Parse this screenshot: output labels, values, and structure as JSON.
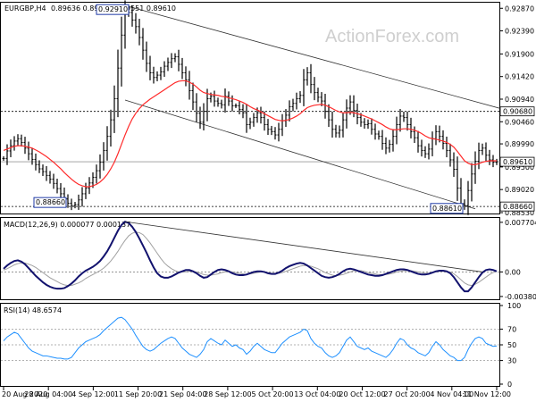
{
  "header": {
    "symbol": "EURGBP,H4",
    "ohlc": "0.89636 0.89731 0.89551 0.89610"
  },
  "watermark": "ActionForex.com",
  "chart_data": {
    "type": "candlestick",
    "price_axis": {
      "ticks": [
        "0.92870",
        "0.92390",
        "0.91900",
        "0.91420",
        "0.90940",
        "0.90460",
        "0.89990",
        "0.89500",
        "0.89020",
        "0.88530"
      ],
      "ylim": [
        0.8853,
        0.9297
      ]
    },
    "price_labels": [
      {
        "text": "0.90680",
        "value": 0.9068,
        "kind": "level"
      },
      {
        "text": "0.89610",
        "value": 0.8961,
        "kind": "current"
      },
      {
        "text": "0.88660",
        "value": 0.8866,
        "kind": "level"
      }
    ],
    "annotations": [
      {
        "text": "0.92910",
        "value": 0.9291,
        "x_index": 34
      },
      {
        "text": "0.88660",
        "value": 0.8866,
        "x_index": 20
      },
      {
        "text": "0.88610",
        "value": 0.8861,
        "x_index": 129
      }
    ],
    "horizontal_levels": [
      0.9068,
      0.8866
    ],
    "current_price": 0.8961,
    "time_axis": [
      "20 Aug 2020",
      "28 Aug 04:00",
      "4 Sep 12:00",
      "11 Sep 20:00",
      "21 Sep 04:00",
      "28 Sep 12:00",
      "5 Oct 20:00",
      "13 Oct 04:00",
      "20 Oct 12:00",
      "27 Oct 20:00",
      "4 Nov 04:00",
      "11 Nov 12:00"
    ],
    "close": [
      0.8968,
      0.8984,
      0.8995,
      0.9005,
      0.901,
      0.9002,
      0.899,
      0.8978,
      0.8966,
      0.8955,
      0.8946,
      0.894,
      0.8932,
      0.8924,
      0.8915,
      0.8904,
      0.8893,
      0.8882,
      0.8873,
      0.8868,
      0.887,
      0.888,
      0.8893,
      0.8905,
      0.8916,
      0.8928,
      0.8942,
      0.896,
      0.8985,
      0.9015,
      0.905,
      0.9095,
      0.916,
      0.923,
      0.9275,
      0.9278,
      0.9262,
      0.9248,
      0.9225,
      0.9198,
      0.917,
      0.915,
      0.914,
      0.9145,
      0.9152,
      0.9164,
      0.9172,
      0.918,
      0.9184,
      0.9168,
      0.915,
      0.9135,
      0.9112,
      0.9088,
      0.9064,
      0.9045,
      0.9068,
      0.9095,
      0.91,
      0.909,
      0.9085,
      0.9082,
      0.91,
      0.909,
      0.908,
      0.908,
      0.9072,
      0.9065,
      0.904,
      0.9045,
      0.9055,
      0.9065,
      0.9055,
      0.904,
      0.903,
      0.9025,
      0.9018,
      0.903,
      0.9048,
      0.906,
      0.9078,
      0.9085,
      0.9095,
      0.9102,
      0.9135,
      0.915,
      0.9125,
      0.9108,
      0.9098,
      0.909,
      0.9068,
      0.905,
      0.903,
      0.9022,
      0.9028,
      0.905,
      0.9075,
      0.9088,
      0.907,
      0.9055,
      0.9045,
      0.904,
      0.9042,
      0.903,
      0.902,
      0.9015,
      0.9,
      0.899,
      0.8998,
      0.9015,
      0.904,
      0.9058,
      0.9055,
      0.904,
      0.9025,
      0.9012,
      0.8995,
      0.8985,
      0.8978,
      0.8988,
      0.901,
      0.9025,
      0.9015,
      0.9,
      0.8985,
      0.8965,
      0.8945,
      0.8905,
      0.8872,
      0.8868,
      0.89,
      0.8935,
      0.8962,
      0.8985,
      0.899,
      0.8975,
      0.8965,
      0.896,
      0.8961
    ],
    "ma": [
      0.8985,
      0.8988,
      0.8991,
      0.8994,
      0.8995,
      0.8995,
      0.8994,
      0.8992,
      0.899,
      0.8986,
      0.8982,
      0.8977,
      0.8972,
      0.8966,
      0.896,
      0.8953,
      0.8946,
      0.8938,
      0.8931,
      0.8924,
      0.8918,
      0.8913,
      0.891,
      0.8908,
      0.8908,
      0.891,
      0.8913,
      0.8918,
      0.8925,
      0.8934,
      0.8946,
      0.896,
      0.8978,
      0.8998,
      0.9018,
      0.9036,
      0.9052,
      0.9064,
      0.9074,
      0.9082,
      0.9088,
      0.9094,
      0.9099,
      0.9104,
      0.9109,
      0.9114,
      0.9119,
      0.9124,
      0.9129,
      0.9132,
      0.9133,
      0.9133,
      0.913,
      0.9126,
      0.912,
      0.9113,
      0.9108,
      0.9106,
      0.9104,
      0.9103,
      0.9102,
      0.91,
      0.9099,
      0.9097,
      0.9095,
      0.9093,
      0.909,
      0.9087,
      0.9083,
      0.9078,
      0.9074,
      0.9071,
      0.9067,
      0.9063,
      0.9059,
      0.9055,
      0.9051,
      0.9049,
      0.9048,
      0.9049,
      0.9051,
      0.9054,
      0.9058,
      0.9063,
      0.907,
      0.9076,
      0.9079,
      0.9081,
      0.9082,
      0.9083,
      0.9081,
      0.9078,
      0.9074,
      0.907,
      0.9067,
      0.9065,
      0.9065,
      0.9066,
      0.9065,
      0.9063,
      0.9061,
      0.9058,
      0.9055,
      0.9052,
      0.9048,
      0.9044,
      0.904,
      0.9035,
      0.9031,
      0.9029,
      0.9029,
      0.903,
      0.9031,
      0.9031,
      0.903,
      0.9028,
      0.9025,
      0.9021,
      0.9016,
      0.9012,
      0.901,
      0.9009,
      0.9007,
      0.9005,
      0.9002,
      0.8998,
      0.8992,
      0.8983,
      0.8973,
      0.8963,
      0.8958,
      0.8955,
      0.8955,
      0.8957,
      0.896,
      0.8962,
      0.8963,
      0.8963,
      0.8963
    ],
    "channel": {
      "upper": [
        [
          34,
          0.9293
        ],
        [
          142,
          0.9068
        ]
      ],
      "lower": [
        [
          34,
          0.9092
        ],
        [
          132,
          0.8861
        ]
      ]
    },
    "macd": {
      "label": "MACD(12,26,9) 0.000077 0.000137",
      "ticks": [
        "0.007704",
        "0.00",
        "-0.003804"
      ],
      "ylim": [
        -0.0041,
        0.0081
      ],
      "main": [
        0.0005,
        0.001,
        0.0014,
        0.0017,
        0.0018,
        0.0016,
        0.0012,
        0.0006,
        0.0,
        -0.0006,
        -0.0011,
        -0.0016,
        -0.002,
        -0.0023,
        -0.0025,
        -0.0026,
        -0.0026,
        -0.0025,
        -0.0022,
        -0.0018,
        -0.0013,
        -0.0007,
        -0.0002,
        0.0002,
        0.0005,
        0.0008,
        0.0012,
        0.0017,
        0.0024,
        0.0032,
        0.0042,
        0.0053,
        0.0064,
        0.0073,
        0.0078,
        0.0076,
        0.007,
        0.0062,
        0.0052,
        0.0041,
        0.003,
        0.0018,
        0.0007,
        -0.0002,
        -0.0007,
        -0.0009,
        -0.0009,
        -0.0007,
        -0.0004,
        -0.0001,
        0.0001,
        0.0003,
        0.0003,
        0.0001,
        -0.0002,
        -0.0006,
        -0.0009,
        -0.0008,
        -0.0004,
        0.0,
        0.0003,
        0.0004,
        0.0003,
        0.0001,
        -0.0002,
        -0.0004,
        -0.0005,
        -0.0005,
        -0.0004,
        -0.0002,
        0.0,
        0.0001,
        0.0001,
        0.0,
        -0.0002,
        -0.0003,
        -0.0003,
        -0.0001,
        0.0002,
        0.0006,
        0.0009,
        0.0011,
        0.0013,
        0.0014,
        0.0013,
        0.001,
        0.0006,
        0.0002,
        -0.0002,
        -0.0006,
        -0.0008,
        -0.0009,
        -0.0008,
        -0.0006,
        -0.0003,
        0.0001,
        0.0004,
        0.0005,
        0.0004,
        0.0002,
        0.0,
        -0.0002,
        -0.0004,
        -0.0005,
        -0.0006,
        -0.0006,
        -0.0005,
        -0.0003,
        -0.0001,
        0.0001,
        0.0003,
        0.0004,
        0.0004,
        0.0003,
        0.0001,
        -0.0001,
        -0.0003,
        -0.0004,
        -0.0004,
        -0.0003,
        -0.0001,
        0.0001,
        0.0002,
        0.0002,
        0.0001,
        -0.0002,
        -0.0008,
        -0.0016,
        -0.0024,
        -0.003,
        -0.003,
        -0.0024,
        -0.0016,
        -0.0008,
        -0.0001,
        0.0003,
        0.0004,
        0.0003,
        0.0001
      ],
      "signal": [
        0.0003,
        0.0005,
        0.0008,
        0.0011,
        0.0013,
        0.0014,
        0.0014,
        0.0012,
        0.001,
        0.0007,
        0.0003,
        -0.0001,
        -0.0005,
        -0.0009,
        -0.0012,
        -0.0015,
        -0.0018,
        -0.002,
        -0.0021,
        -0.0021,
        -0.0019,
        -0.0017,
        -0.0014,
        -0.001,
        -0.0007,
        -0.0004,
        -0.0001,
        0.0002,
        0.0006,
        0.0011,
        0.0017,
        0.0024,
        0.0032,
        0.0041,
        0.0049,
        0.0056,
        0.006,
        0.0062,
        0.0061,
        0.0058,
        0.0052,
        0.0045,
        0.0037,
        0.0029,
        0.0021,
        0.0014,
        0.0009,
        0.0005,
        0.0002,
        0.0,
        0.0,
        0.0,
        0.0001,
        0.0001,
        0.0,
        -0.0002,
        -0.0004,
        -0.0005,
        -0.0005,
        -0.0004,
        -0.0003,
        -0.0001,
        0.0,
        0.0001,
        0.0,
        -0.0001,
        -0.0002,
        -0.0003,
        -0.0004,
        -0.0003,
        -0.0002,
        -0.0001,
        0.0,
        0.0,
        -0.0001,
        -0.0002,
        -0.0002,
        -0.0002,
        -0.0001,
        0.0001,
        0.0003,
        0.0005,
        0.0007,
        0.0009,
        0.001,
        0.001,
        0.0009,
        0.0007,
        0.0005,
        0.0002,
        -0.0001,
        -0.0003,
        -0.0005,
        -0.0006,
        -0.0005,
        -0.0004,
        -0.0002,
        0.0,
        0.0002,
        0.0002,
        0.0002,
        0.0001,
        -0.0001,
        -0.0002,
        -0.0003,
        -0.0004,
        -0.0004,
        -0.0004,
        -0.0003,
        -0.0002,
        0.0,
        0.0001,
        0.0002,
        0.0002,
        0.0002,
        0.0001,
        0.0,
        -0.0001,
        -0.0002,
        -0.0002,
        -0.0001,
        0.0,
        0.0001,
        0.0001,
        0.0001,
        0.0,
        -0.0003,
        -0.0007,
        -0.0012,
        -0.0017,
        -0.002,
        -0.0021,
        -0.0019,
        -0.0016,
        -0.0012,
        -0.0008,
        -0.0004,
        -0.0001,
        0.0001
      ],
      "trendline": [
        [
          34,
          0.0078
        ],
        [
          134,
          0.0
        ]
      ]
    },
    "rsi": {
      "label": "RSI(14) 48.6574",
      "ticks": [
        "100",
        "70",
        "50",
        "30",
        "0"
      ],
      "ylim": [
        0,
        100
      ],
      "levels": [
        70,
        50,
        30
      ],
      "values": [
        55,
        60,
        63,
        66,
        64,
        58,
        52,
        46,
        42,
        40,
        38,
        36,
        36,
        35,
        34,
        33,
        33,
        32,
        32,
        34,
        40,
        46,
        50,
        54,
        56,
        58,
        60,
        63,
        68,
        72,
        76,
        80,
        84,
        85,
        82,
        76,
        70,
        62,
        55,
        48,
        44,
        42,
        44,
        48,
        52,
        55,
        58,
        60,
        58,
        52,
        46,
        42,
        38,
        36,
        34,
        38,
        44,
        54,
        58,
        55,
        52,
        50,
        56,
        52,
        48,
        50,
        46,
        44,
        38,
        42,
        48,
        52,
        48,
        44,
        42,
        40,
        40,
        46,
        52,
        56,
        60,
        62,
        64,
        66,
        70,
        68,
        58,
        52,
        48,
        46,
        40,
        36,
        34,
        36,
        40,
        48,
        56,
        60,
        54,
        48,
        46,
        44,
        46,
        42,
        40,
        38,
        36,
        34,
        38,
        44,
        52,
        58,
        56,
        50,
        46,
        44,
        40,
        38,
        36,
        40,
        48,
        54,
        50,
        44,
        40,
        36,
        34,
        30,
        30,
        34,
        44,
        52,
        58,
        60,
        58,
        52,
        50,
        48,
        48.6
      ]
    }
  }
}
